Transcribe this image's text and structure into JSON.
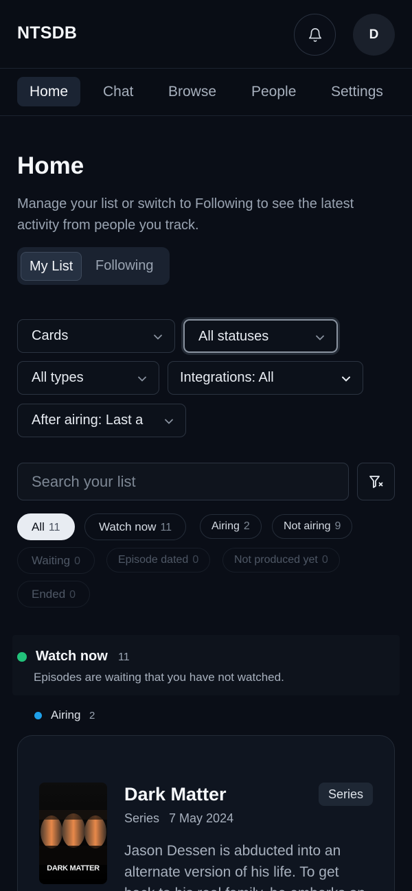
{
  "header": {
    "brand": "NTSDB",
    "avatar_initial": "D",
    "bell_icon": "bell-icon"
  },
  "nav": [
    {
      "label": "Home",
      "active": true
    },
    {
      "label": "Chat"
    },
    {
      "label": "Browse"
    },
    {
      "label": "People"
    },
    {
      "label": "Settings"
    }
  ],
  "page": {
    "title": "Home",
    "description": "Manage your list or switch to Following to see the latest activity from people you track."
  },
  "segmented": {
    "my_list": "My List",
    "following": "Following",
    "selected": "My List"
  },
  "filters": {
    "view": "Cards",
    "status": "All statuses",
    "type": "All types",
    "integrations": "Integrations: All",
    "after_airing": "After airing: Last a"
  },
  "search": {
    "placeholder": "Search your list",
    "value": ""
  },
  "chips": [
    {
      "label": "All",
      "count": "11",
      "state": "active"
    },
    {
      "label": "Watch now",
      "count": "11",
      "state": "normal"
    },
    {
      "label": "Airing",
      "count": "2",
      "state": "normal"
    },
    {
      "label": "Not airing",
      "count": "9",
      "state": "normal"
    },
    {
      "label": "Waiting",
      "count": "0",
      "state": "disabled"
    },
    {
      "label": "Episode dated",
      "count": "0",
      "state": "disabled"
    },
    {
      "label": "Not produced yet",
      "count": "0",
      "state": "disabled"
    },
    {
      "label": "Ended",
      "count": "0",
      "state": "disabled"
    }
  ],
  "group": {
    "title": "Watch now",
    "count": "11",
    "description": "Episodes are waiting that you have not watched.",
    "color": "#22c17a"
  },
  "subgroup": {
    "label": "Airing",
    "count": "2",
    "color": "#1ea0ea"
  },
  "card": {
    "title": "Dark Matter",
    "badge": "Series",
    "type": "Series",
    "date": "7 May 2024",
    "description": "Jason Dessen is abducted into an alternate version of his life. To get back to his real family, he embarks on",
    "poster_text": "DARK MATTER"
  }
}
